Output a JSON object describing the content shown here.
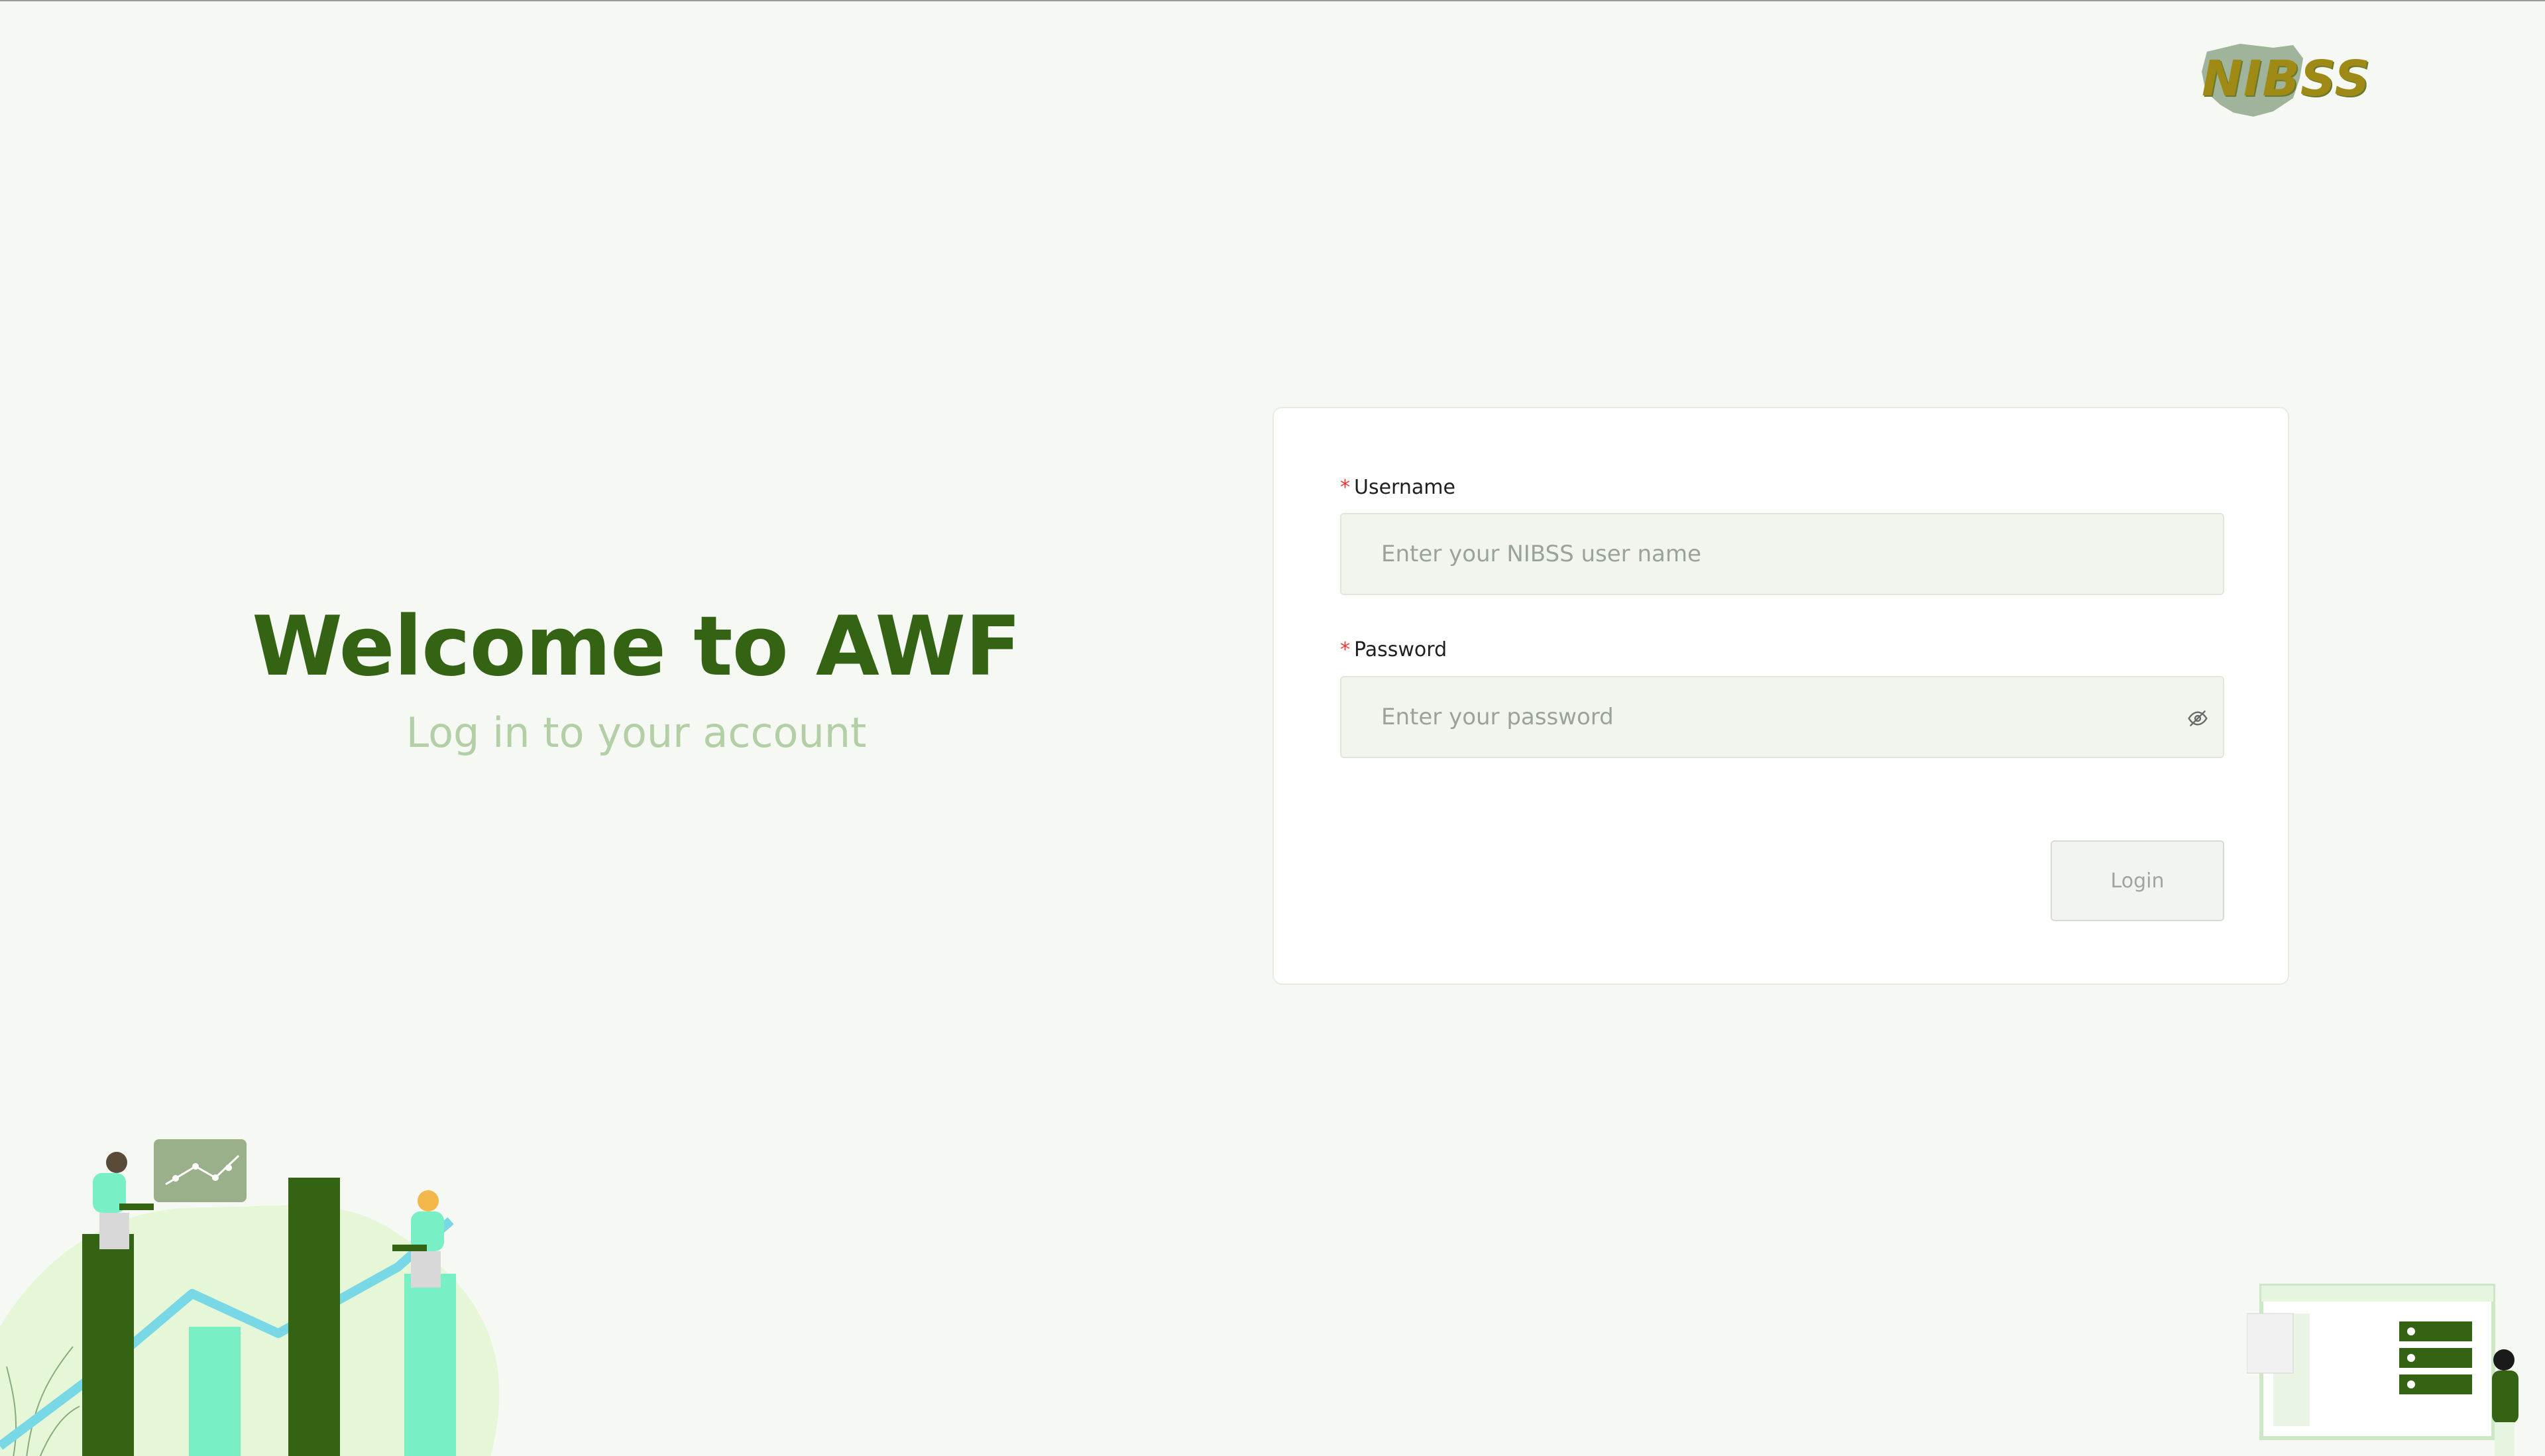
{
  "logo": {
    "text": "NIBSS"
  },
  "welcome": {
    "title": "Welcome to AWF",
    "subtitle": "Log in to your account"
  },
  "form": {
    "username": {
      "label": "Username",
      "required_mark": "*",
      "placeholder": "Enter your NIBSS user name",
      "value": ""
    },
    "password": {
      "label": "Password",
      "required_mark": "*",
      "placeholder": "Enter your password",
      "value": "",
      "toggle_icon": "eye-slash-icon"
    },
    "login_label": "Login"
  },
  "colors": {
    "background": "#f6f8f4",
    "brand_green": "#356314",
    "subtitle_green": "#b3cfa6",
    "required_red": "#e53935",
    "mint": "#79efc5"
  }
}
